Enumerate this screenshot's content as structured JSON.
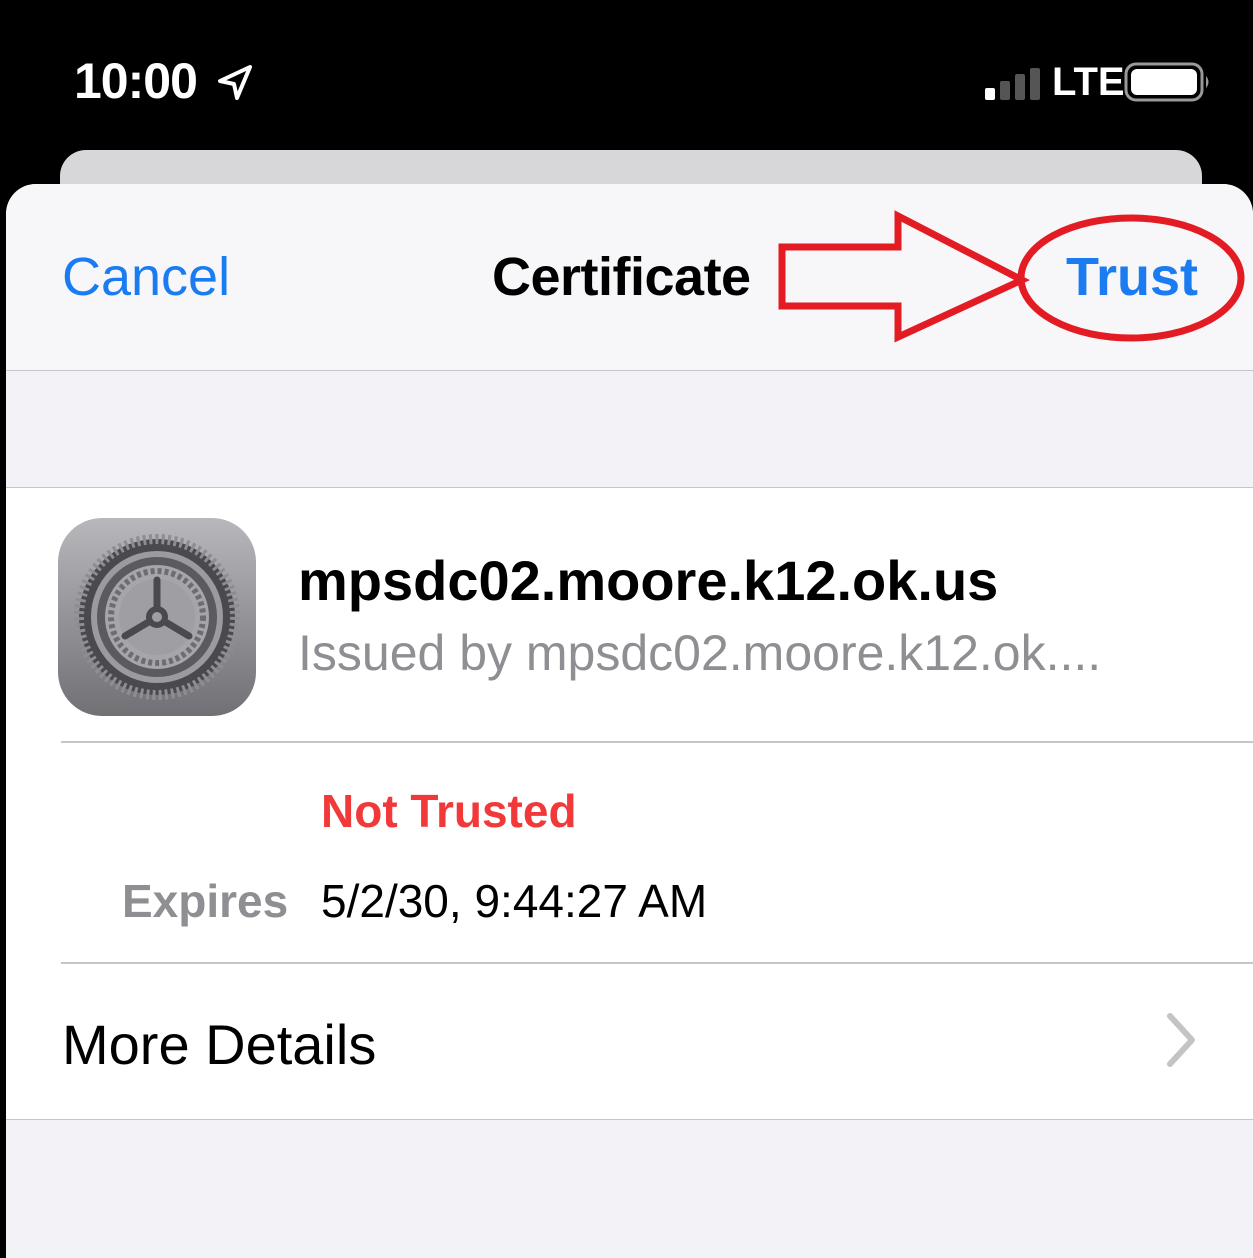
{
  "status_bar": {
    "time": "10:00",
    "network": "LTE",
    "icons": [
      "location-arrow-icon",
      "signal-icon",
      "battery-icon"
    ]
  },
  "nav": {
    "cancel_label": "Cancel",
    "title": "Certificate",
    "trust_label": "Trust"
  },
  "certificate": {
    "icon": "settings-gear-icon",
    "name": "mpsdc02.moore.k12.ok.us",
    "issuer": "Issued by mpsdc02.moore.k12.ok....",
    "status": "Not Trusted",
    "expires_label": "Expires",
    "expires_value": "5/2/30, 9:44:27 AM"
  },
  "more_details": {
    "label": "More Details",
    "icon": "chevron-right-icon"
  },
  "colors": {
    "accent_blue": "#1a7cf0",
    "warning_red": "#f2393a",
    "annotation_red": "#e31b23",
    "secondary_gray": "#8e8e93"
  }
}
